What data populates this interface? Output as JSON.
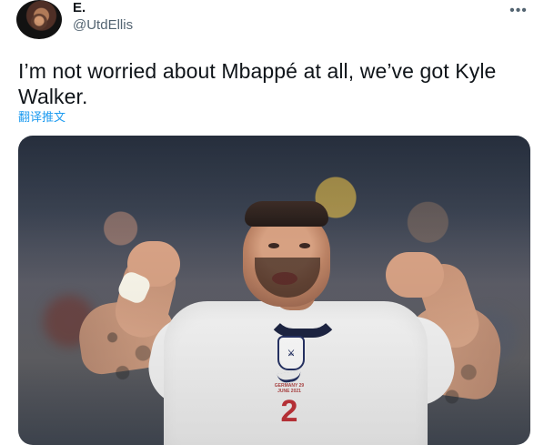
{
  "header": {
    "display_name": "E.",
    "handle": "@UtdEllis",
    "more_label": "•••"
  },
  "tweet": {
    "text": "I’m not worried about Mbappé at all, we’ve got Kyle Walker.",
    "translate_label": "翻译推文"
  },
  "media": {
    "shirt_number": "2",
    "badge_text": "GERMANY\n29 JUNE 2021"
  },
  "colors": {
    "text_primary": "#0f1419",
    "text_secondary": "#536471",
    "link": "#1d9bf0"
  }
}
